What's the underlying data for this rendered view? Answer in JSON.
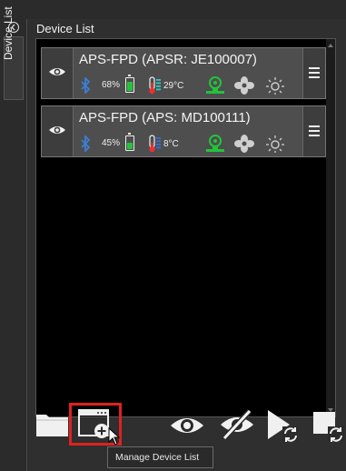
{
  "sidebar": {
    "tab_label": "Device List"
  },
  "panel": {
    "title": "Device List"
  },
  "devices": [
    {
      "name": "APS-FPD (APSR: JE100007)",
      "battery_percent": "68%",
      "battery_level": 0.68,
      "temperature": "29°C",
      "thermometer_color": "#2ec8c8"
    },
    {
      "name": "APS-FPD (APS: MD100111)",
      "battery_percent": "45%",
      "battery_level": 0.45,
      "temperature": "8°C",
      "thermometer_color": "#3a6de0"
    }
  ],
  "toolbar": {
    "tooltip": "Manage Device List"
  },
  "colors": {
    "background": "#2b2b2b",
    "card": "#4e4e4e",
    "accent_green": "#22c43a",
    "bluetooth_blue": "#3b7fd6",
    "highlight_red": "#e02020"
  },
  "icons": [
    "collapse-icon",
    "eye-icon",
    "bluetooth-icon",
    "battery-icon",
    "thermometer-icon",
    "agitator-icon",
    "fan-icon",
    "light-icon",
    "menu-icon",
    "folder-icon",
    "manage-device-list-icon",
    "show-icon",
    "hide-icon",
    "cursor-icon"
  ]
}
